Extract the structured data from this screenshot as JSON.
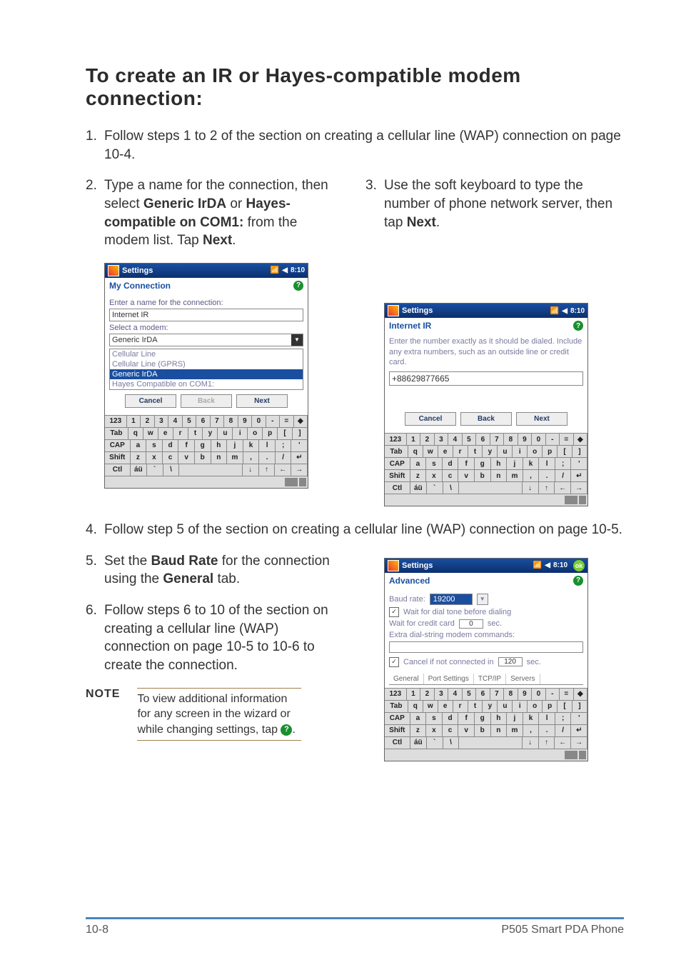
{
  "heading": "To create an IR or Hayes-compatible modem connection:",
  "steps": {
    "s1": {
      "n": "1.",
      "text_a": "Follow steps 1 to 2 of the section on creating a cellular line (WAP) connection on page 10-4."
    },
    "s2": {
      "n": "2.",
      "text_a": "Type a name for the connection, then select ",
      "b1": "Generic IrDA",
      "text_b": " or ",
      "b2": "Hayes-compatible on COM1:",
      "text_c": " from the modem list. Tap ",
      "b3": "Next",
      "text_d": "."
    },
    "s3": {
      "n": "3.",
      "text_a": "Use the soft keyboard to type the number of phone network server, then tap ",
      "b1": "Next",
      "text_b": "."
    },
    "s4": {
      "n": "4.",
      "text_a": "Follow step 5 of the section on creating a cellular line (WAP) connection on page 10-5."
    },
    "s5": {
      "n": "5.",
      "text_a": "Set the ",
      "b1": "Baud Rate",
      "text_b": " for the connection using the ",
      "b2": "General",
      "text_c": " tab."
    },
    "s6": {
      "n": "6.",
      "text_a": "Follow steps 6 to 10 of the section on creating a cellular line (WAP) connection on page 10-5 to 10-6 to create the connection."
    }
  },
  "note": {
    "label": "NOTE",
    "text": "To view additional information for any screen in the wizard or while changing settings, tap ",
    "icon": "?",
    "period": "."
  },
  "pda_common": {
    "settings": "Settings",
    "clock": "8:10",
    "help": "?"
  },
  "pda1": {
    "sub": "My Connection",
    "lbl_name": "Enter a name for the connection:",
    "name_value": "Internet IR",
    "lbl_modem": "Select a modem:",
    "modem_value": "Generic IrDA",
    "list": [
      "Cellular Line",
      "Cellular Line (GPRS)",
      "Generic IrDA",
      "Hayes Compatible on COM1:"
    ],
    "selected": "Generic IrDA",
    "btn_cancel": "Cancel",
    "btn_back": "Back",
    "btn_next": "Next"
  },
  "pda2": {
    "sub": "Internet IR",
    "help_text": "Enter the number exactly as it should be dialed.  Include any extra numbers, such as an outside line or credit card.",
    "number": "+88629877665",
    "btn_cancel": "Cancel",
    "btn_back": "Back",
    "btn_next": "Next"
  },
  "pda3": {
    "sub": "Advanced",
    "ok": "ok",
    "lbl_baud": "Baud rate:",
    "baud_value": "19200",
    "chk_dialtone": "Wait for dial tone before dialing",
    "lbl_credit_a": "Wait for credit card",
    "credit_value": "0",
    "lbl_credit_b": "sec.",
    "lbl_extra": "Extra dial-string modem commands:",
    "chk_cancel": "Cancel if not connected in",
    "cancel_value": "120",
    "lbl_sec": "sec.",
    "tabs": [
      "General",
      "Port Settings",
      "TCP/IP",
      "Servers"
    ]
  },
  "kbd": {
    "r1": [
      "123",
      "1",
      "2",
      "3",
      "4",
      "5",
      "6",
      "7",
      "8",
      "9",
      "0",
      "-",
      "=",
      "◆"
    ],
    "r2": [
      "Tab",
      "q",
      "w",
      "e",
      "r",
      "t",
      "y",
      "u",
      "i",
      "o",
      "p",
      "[",
      "]"
    ],
    "r3": [
      "CAP",
      "a",
      "s",
      "d",
      "f",
      "g",
      "h",
      "j",
      "k",
      "l",
      ";",
      "'"
    ],
    "r4": [
      "Shift",
      "z",
      "x",
      "c",
      "v",
      "b",
      "n",
      "m",
      ",",
      ".",
      "/",
      "↵"
    ],
    "r5": [
      "Ctl",
      "áü",
      "`",
      "\\",
      "",
      "",
      "",
      "",
      "↓",
      "↑",
      "←",
      "→"
    ]
  },
  "footer": {
    "left": "10-8",
    "right": "P505 Smart PDA Phone"
  }
}
